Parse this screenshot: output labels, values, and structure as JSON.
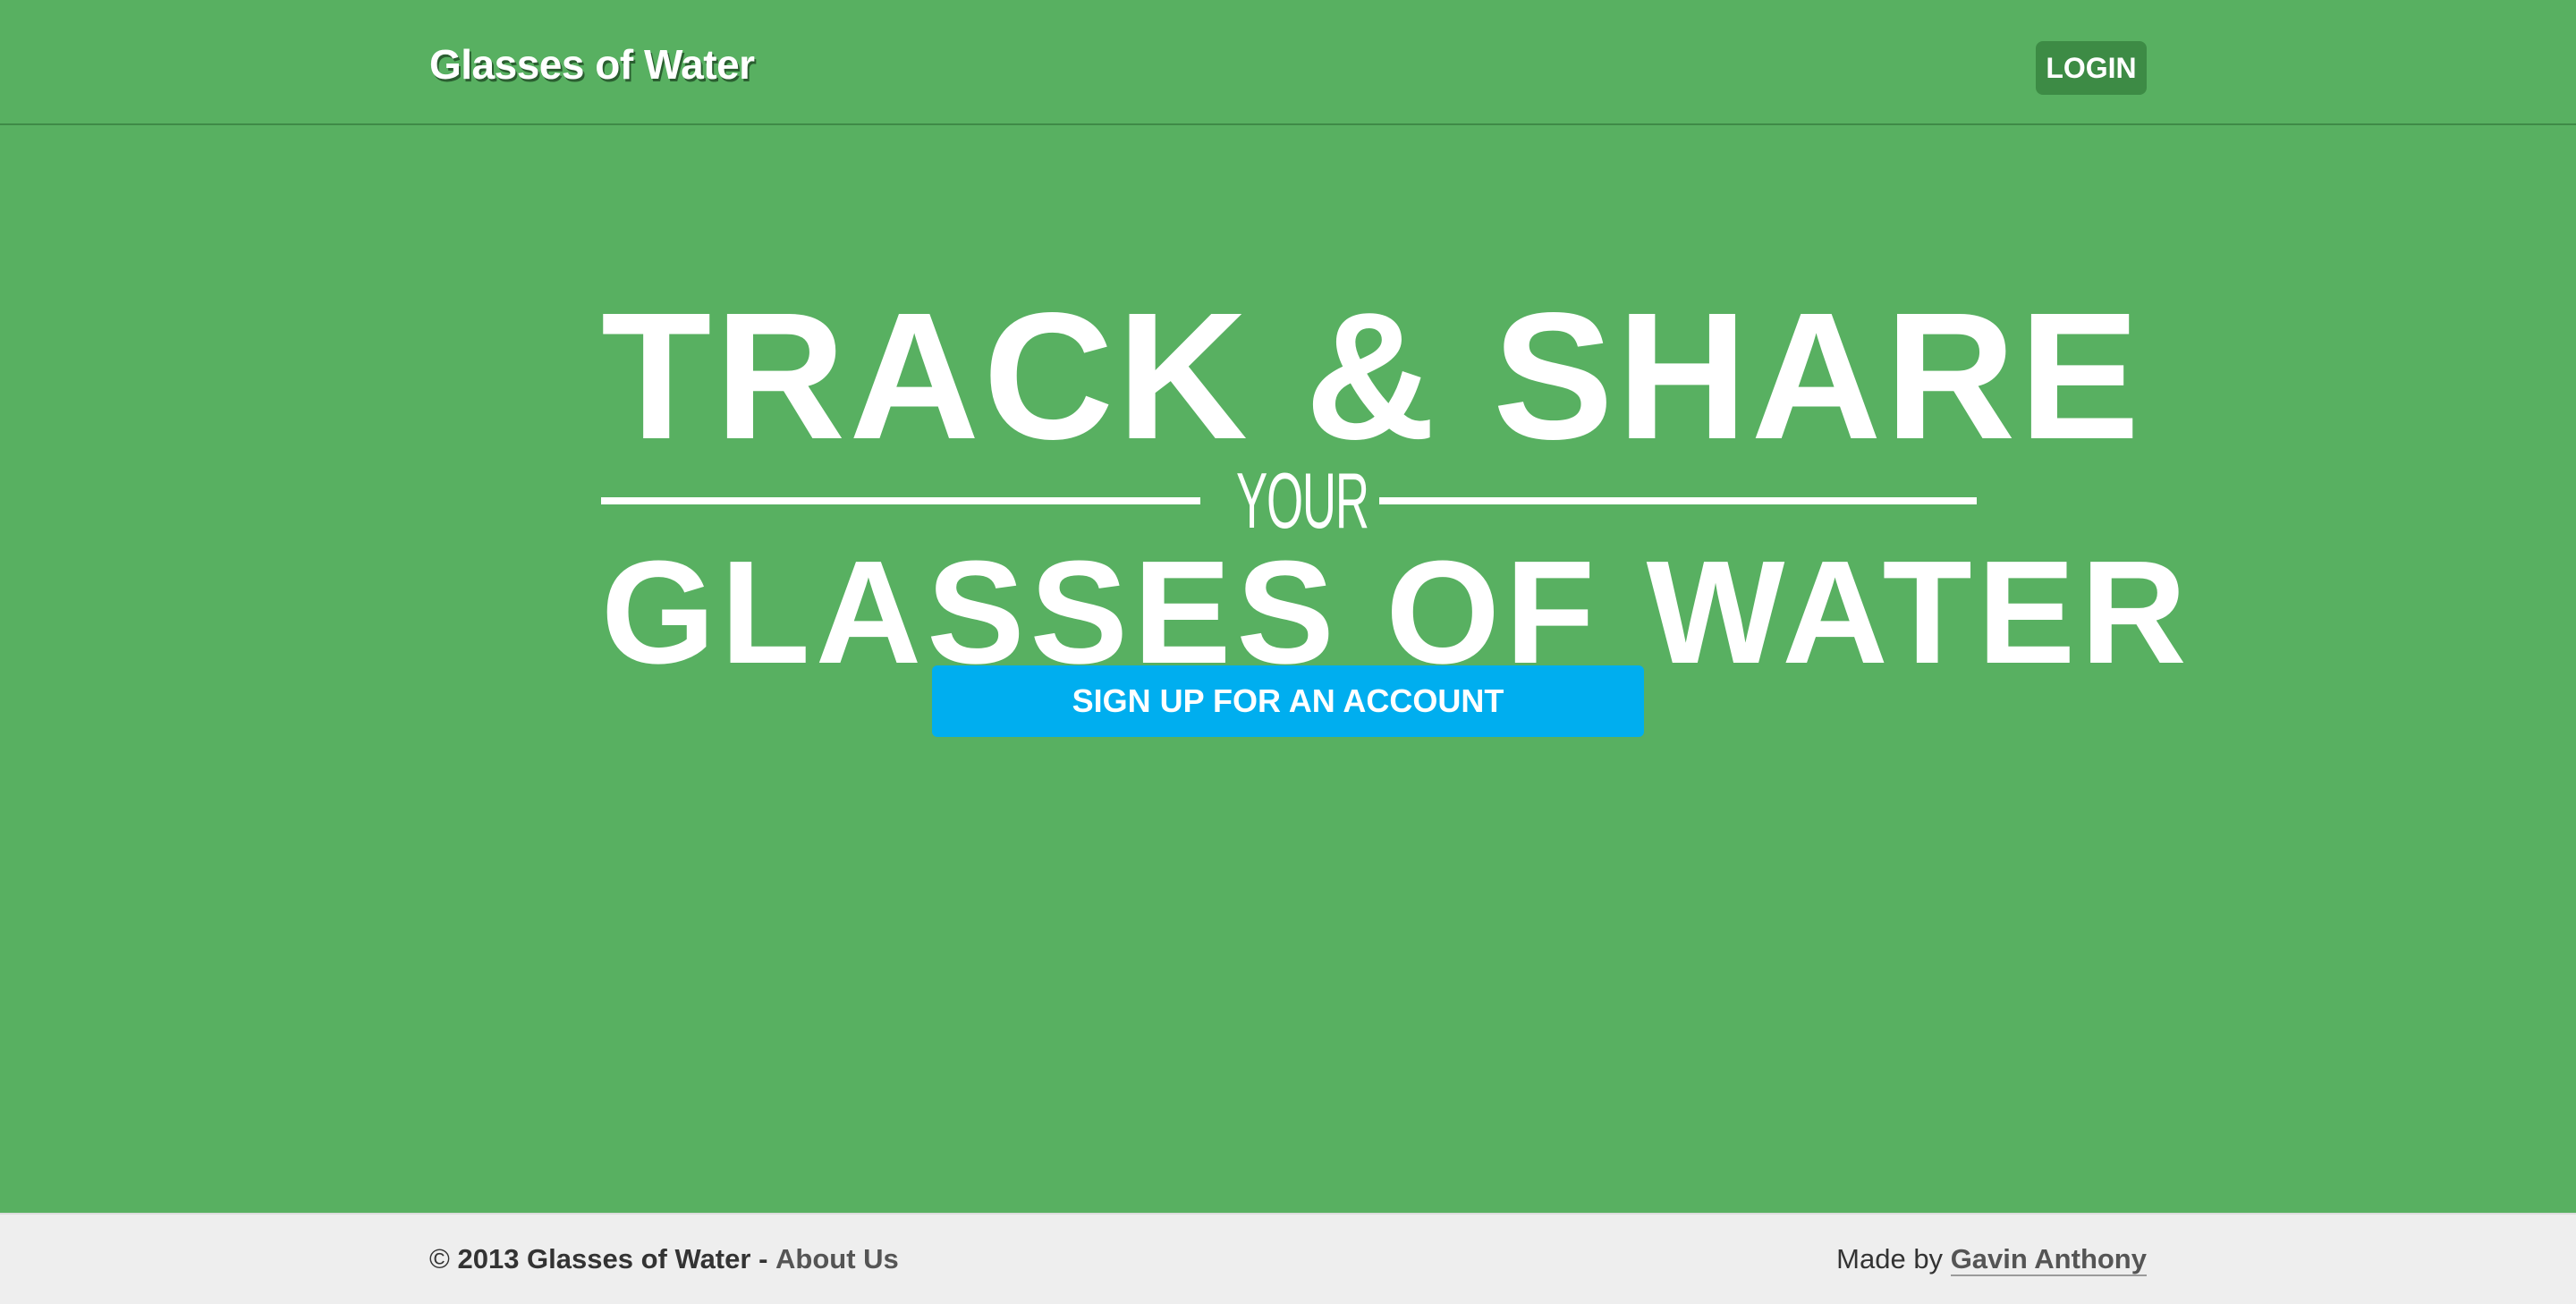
{
  "header": {
    "brand": "Glasses of Water",
    "login_label": "LOGIN"
  },
  "hero": {
    "line1": "TRACK & SHARE",
    "connector": "YOUR",
    "line2": "GLASSES OF WATER",
    "signup_label": "SIGN UP FOR AN ACCOUNT"
  },
  "footer": {
    "copyright_symbol": "©",
    "copyright_text": "2013 Glasses of Water",
    "separator": "-",
    "about_link": "About Us",
    "made_by_prefix": "Made by",
    "author_link": "Gavin Anthony"
  },
  "colors": {
    "background": "#58b061",
    "login_button": "#3d8b45",
    "signup_button": "#00aeef",
    "footer_background": "#eeeeee"
  }
}
